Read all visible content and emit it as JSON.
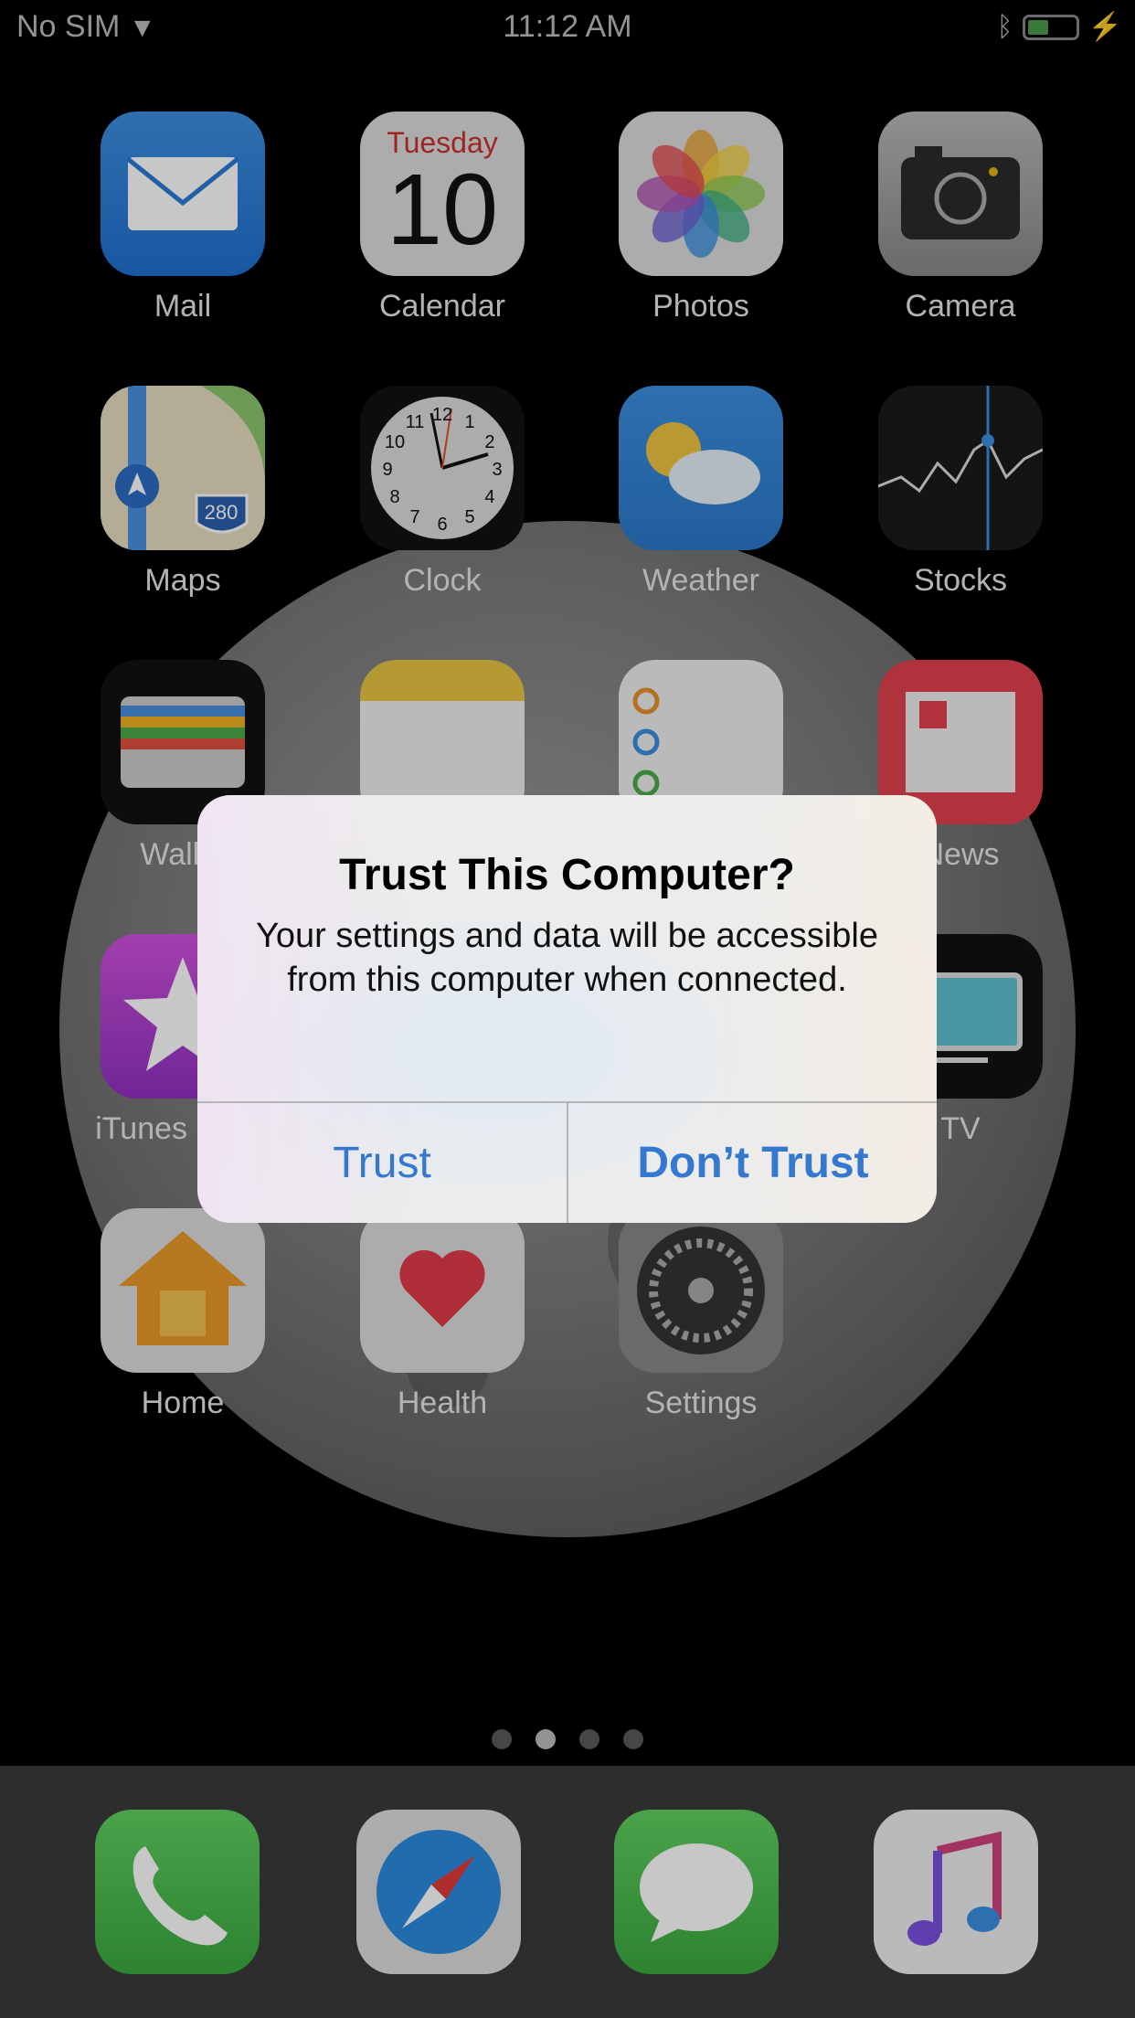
{
  "status_bar": {
    "carrier": "No SIM",
    "time": "11:12 AM",
    "battery_level": 0.45,
    "charging": true,
    "bluetooth": true,
    "wifi": true
  },
  "apps": {
    "mail": "Mail",
    "calendar": "Calendar",
    "calendar_day": "Tuesday",
    "calendar_date": "10",
    "photos": "Photos",
    "camera": "Camera",
    "maps": "Maps",
    "maps_shield": "280",
    "clock": "Clock",
    "weather": "Weather",
    "stocks": "Stocks",
    "wallet": "Wallet",
    "news": "News",
    "itunes": "iTunes Store",
    "tv": "TV",
    "home": "Home",
    "health": "Health",
    "settings": "Settings"
  },
  "clock_numbers": [
    "12",
    "1",
    "2",
    "3",
    "4",
    "5",
    "6",
    "7",
    "8",
    "9",
    "10",
    "11"
  ],
  "page_indicator": {
    "pages": 4,
    "current": 2
  },
  "dock": [
    "phone-icon",
    "safari-icon",
    "messages-icon",
    "music-icon"
  ],
  "dialog": {
    "title": "Trust This Computer?",
    "message": "Your settings and data will be accessible from this computer when connected.",
    "trust_label": "Trust",
    "dont_trust_label": "Don’t Trust",
    "accent": "#3478d0"
  }
}
